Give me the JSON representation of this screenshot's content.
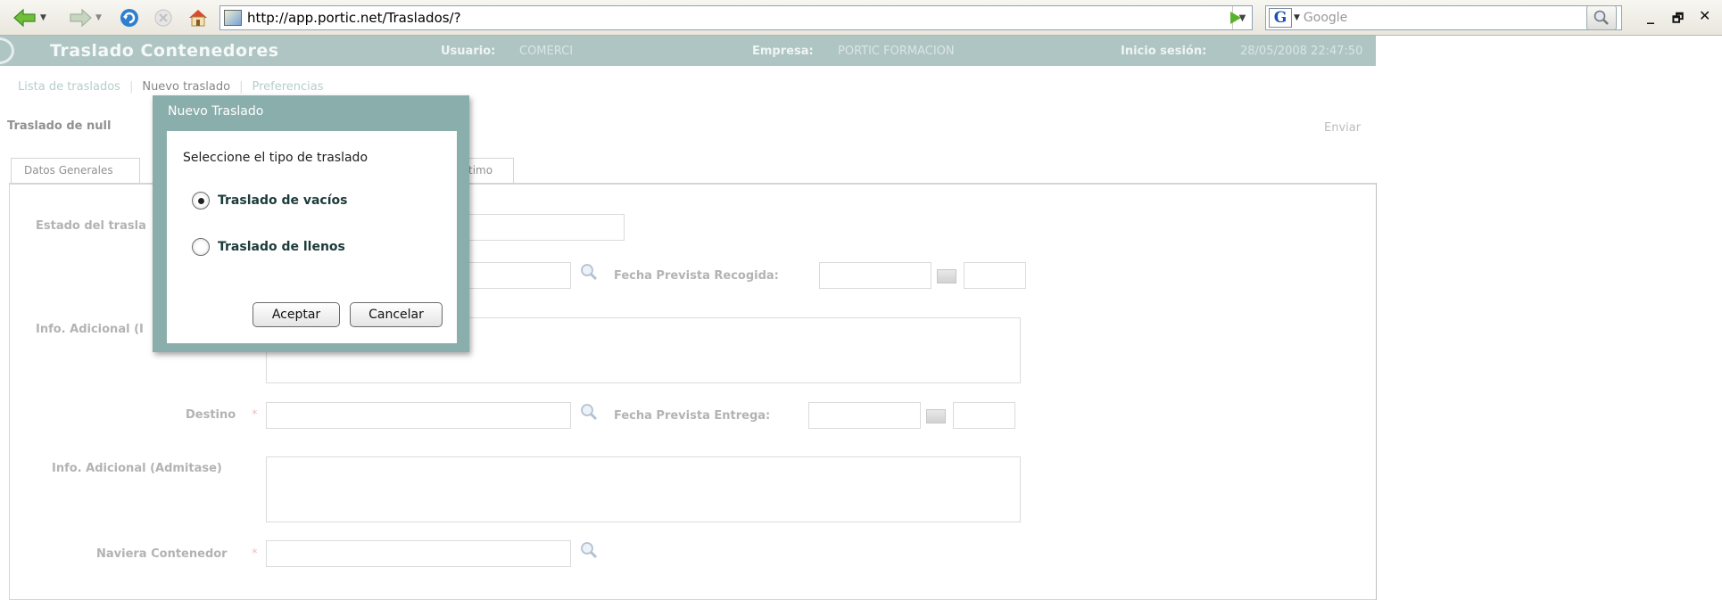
{
  "browser": {
    "url": "http://app.portic.net/Traslados/?",
    "search_placeholder": "Google",
    "search_logo": "G"
  },
  "header": {
    "title": "Traslado Contenedores",
    "user_label": "Usuario:",
    "user_value": "COMERCI",
    "company_label": "Empresa:",
    "company_value": "PORTIC FORMACION",
    "session_label": "Inicio sesión:",
    "session_value": "28/05/2008 22:47:50"
  },
  "nav": {
    "items": [
      "Lista de traslados",
      "Nuevo traslado",
      "Preferencias"
    ]
  },
  "page": {
    "title": "Traslado de null",
    "send_label": "Enviar"
  },
  "tabs": [
    "Datos Generales",
    "timo"
  ],
  "form": {
    "estado_label": "Estado del trasla",
    "fecha_recogida_label": "Fecha Prevista Recogida:",
    "info_origen_label": "Info. Adicional (I",
    "destino_label": "Destino",
    "fecha_entrega_label": "Fecha Prevista Entrega:",
    "info_admitase_label": "Info. Adicional (Admitase)",
    "naviera_label": "Naviera Contenedor",
    "required_mark": "*"
  },
  "modal": {
    "title": "Nuevo Traslado",
    "prompt": "Seleccione el tipo de traslado",
    "options": [
      {
        "label": "Traslado de vacíos",
        "selected": true
      },
      {
        "label": "Traslado de llenos",
        "selected": false
      }
    ],
    "accept_label": "Aceptar",
    "cancel_label": "Cancelar"
  },
  "window_controls": {
    "minimize": "_",
    "restore": "🗗",
    "close": "✕"
  }
}
